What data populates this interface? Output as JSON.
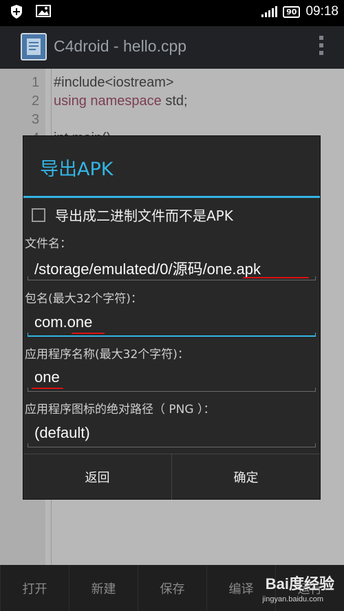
{
  "status_bar": {
    "time": "09:18",
    "battery": "90",
    "icons": [
      "shield-plus-icon",
      "image-icon",
      "signal-icon",
      "battery-icon"
    ]
  },
  "action_bar": {
    "title": "C4droid - hello.cpp",
    "icon": "app-icon",
    "menu_icon": "overflow-menu-icon"
  },
  "editor": {
    "lines": [
      {
        "num": "1",
        "text": "#include<iostream>"
      },
      {
        "num": "2",
        "kw": "using namespace",
        "text": " std;"
      },
      {
        "num": "3",
        "text": ""
      },
      {
        "num": "4",
        "text": "int main()"
      }
    ]
  },
  "dialog": {
    "title": "导出APK",
    "checkbox_label": "导出成二进制文件而不是APK",
    "fields": [
      {
        "label": "文件名：",
        "value": "/storage/emulated/0/源码/one.apk"
      },
      {
        "label": "包名(最大32个字符)：",
        "value": "com.one"
      },
      {
        "label": "应用程序名称(最大32个字符)：",
        "value": "one"
      },
      {
        "label": "应用程序图标的绝对路径（ PNG ）：",
        "value": "(default)"
      }
    ],
    "buttons": {
      "back": "返回",
      "ok": "确定"
    }
  },
  "toolbar": {
    "items": [
      "打开",
      "新建",
      "保存",
      "编译",
      "运行"
    ]
  },
  "watermark": {
    "brand": "Bai度经验",
    "url": "jingyan.baidu.com"
  },
  "colors": {
    "accent": "#33b5e5",
    "dialog_bg": "#282828",
    "underline_annotation": "#dd1111"
  }
}
